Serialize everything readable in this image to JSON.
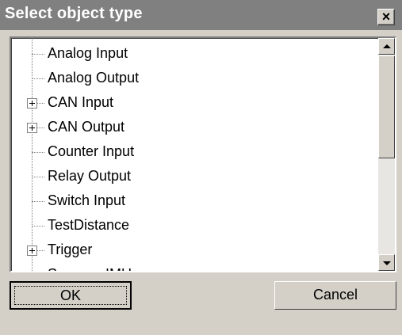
{
  "dialog": {
    "title": "Select object type",
    "close_label": "×"
  },
  "tree": {
    "items": [
      {
        "label": "Analog Input",
        "expandable": false
      },
      {
        "label": "Analog Output",
        "expandable": false
      },
      {
        "label": "CAN Input",
        "expandable": true
      },
      {
        "label": "CAN Output",
        "expandable": true
      },
      {
        "label": "Counter Input",
        "expandable": false
      },
      {
        "label": "Relay Output",
        "expandable": false
      },
      {
        "label": "Switch Input",
        "expandable": false
      },
      {
        "label": "TestDistance",
        "expandable": false
      },
      {
        "label": "Trigger",
        "expandable": true
      },
      {
        "label": "Sensor - IMU",
        "expandable": false
      }
    ]
  },
  "buttons": {
    "ok": "OK",
    "cancel": "Cancel"
  }
}
